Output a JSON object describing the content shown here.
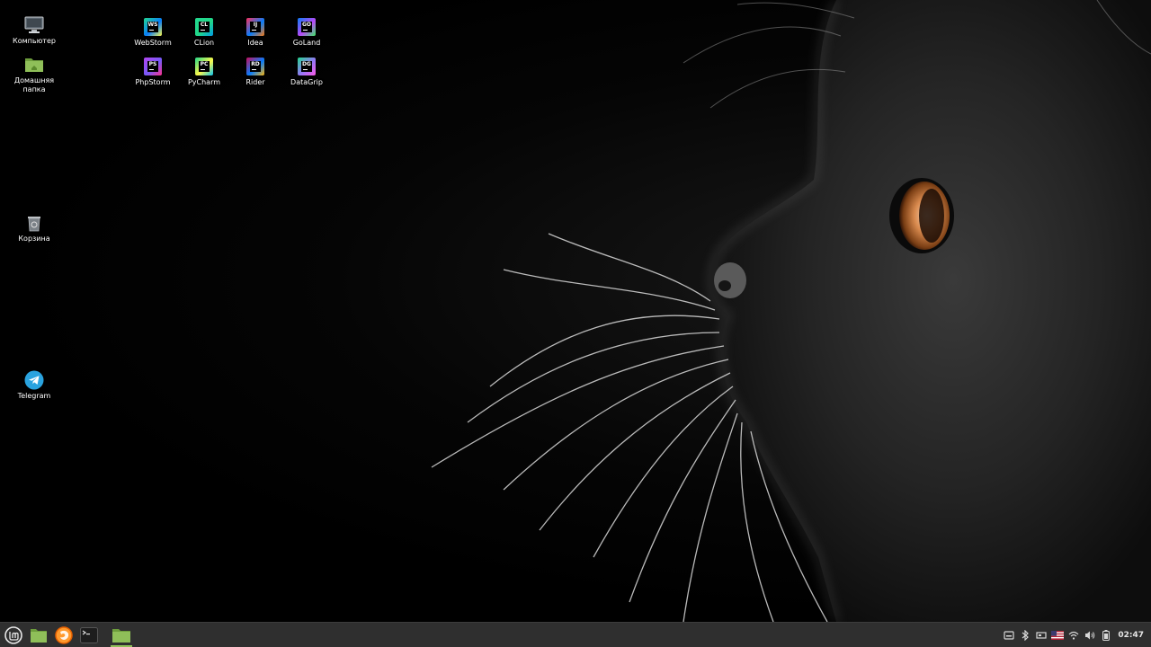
{
  "desktop": {
    "icons_left": [
      {
        "label": "Компьютер",
        "icon": "computer-icon"
      },
      {
        "label": "Домашняя\nпапка",
        "icon": "home-folder-icon"
      },
      {
        "label": "Корзина",
        "icon": "trash-icon"
      },
      {
        "label": "Telegram",
        "icon": "telegram-icon"
      }
    ],
    "jetbrains_apps": [
      {
        "label": "WebStorm",
        "abbr": "WS",
        "colors": [
          "#22d88f",
          "#087cfa",
          "#fcf84a"
        ]
      },
      {
        "label": "CLion",
        "abbr": "CL",
        "colors": [
          "#22d88f",
          "#21d789",
          "#009ae5"
        ]
      },
      {
        "label": "Idea",
        "abbr": "IJ",
        "colors": [
          "#fe315d",
          "#087cfa",
          "#f97a12"
        ]
      },
      {
        "label": "GoLand",
        "abbr": "GO",
        "colors": [
          "#0d7bf7",
          "#b74af7",
          "#3bea62"
        ]
      },
      {
        "label": "PhpStorm",
        "abbr": "PS",
        "colors": [
          "#b345f1",
          "#765af8",
          "#ff318c"
        ]
      },
      {
        "label": "PyCharm",
        "abbr": "PC",
        "colors": [
          "#21d789",
          "#fcf84a",
          "#07c3f2"
        ]
      },
      {
        "label": "Rider",
        "abbr": "RD",
        "colors": [
          "#c90f5e",
          "#077cfb",
          "#fdb60d"
        ]
      },
      {
        "label": "DataGrip",
        "abbr": "DG",
        "colors": [
          "#22d88f",
          "#9775f8",
          "#ff59e6"
        ]
      }
    ]
  },
  "taskbar": {
    "buttons": [
      {
        "name": "menu-button",
        "icon": "linux-mint-icon"
      },
      {
        "name": "show-desktop-button",
        "icon": "folder-icon"
      },
      {
        "name": "firefox-launcher",
        "icon": "firefox-icon"
      },
      {
        "name": "terminal-launcher",
        "icon": "terminal-icon"
      },
      {
        "name": "files-window-button",
        "icon": "folder-icon",
        "active": true
      }
    ],
    "tray": [
      {
        "name": "removable-drives-icon"
      },
      {
        "name": "bluetooth-icon"
      },
      {
        "name": "network-manager-icon"
      },
      {
        "name": "keyboard-layout-flag-icon"
      },
      {
        "name": "wifi-icon"
      },
      {
        "name": "volume-icon"
      },
      {
        "name": "battery-icon"
      }
    ],
    "clock": "02:47"
  },
  "colors": {
    "taskbar_bg": "#2f2f2f",
    "mint_green": "#8fbf59",
    "text": "#ffffff"
  }
}
